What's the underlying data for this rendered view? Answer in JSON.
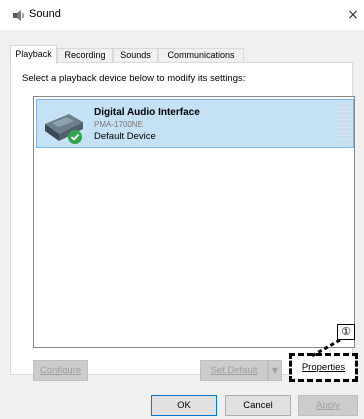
{
  "window": {
    "title": "Sound",
    "close_glyph": "×"
  },
  "tabs": [
    {
      "label": "Playback",
      "active": true
    },
    {
      "label": "Recording",
      "active": false
    },
    {
      "label": "Sounds",
      "active": false
    },
    {
      "label": "Communications",
      "active": false
    }
  ],
  "instruction": "Select a playback device below to modify its settings:",
  "devices": [
    {
      "name": "Digital Audio Interface",
      "model": "PMA-1700NE",
      "status": "Default Device",
      "selected": true,
      "icon": "speaker-device-icon",
      "badge": "check-icon"
    }
  ],
  "buttons": {
    "configure": "Configure",
    "set_default": "Set Default",
    "set_default_arrow": "▼",
    "properties": "Properties",
    "ok": "OK",
    "cancel": "Cancel",
    "apply": "Apply"
  },
  "callout": {
    "number": "①"
  },
  "colors": {
    "selection_bg": "#c4e1f6",
    "selection_border": "#7eb4ea",
    "check_badge": "#2ea44f",
    "disabled_text": "#a0a0a0"
  }
}
